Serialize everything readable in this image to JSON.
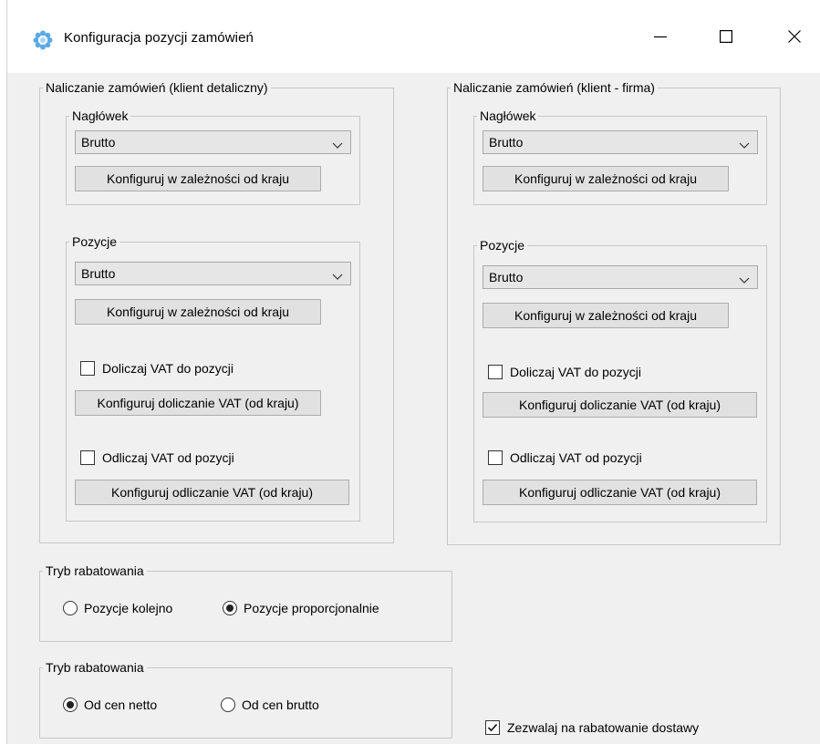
{
  "window": {
    "title": "Konfiguracja pozycji zamówień"
  },
  "retail": {
    "legend": "Naliczanie zamówień (klient detaliczny)",
    "header_group": {
      "legend": "Nagłówek",
      "combo_value": "Brutto",
      "config_button": "Konfiguruj w zależności od kraju"
    },
    "positions_group": {
      "legend": "Pozycje",
      "combo_value": "Brutto",
      "config_button": "Konfiguruj w zależności od kraju",
      "add_vat_label": "Doliczaj VAT do pozycji",
      "add_vat_checked": false,
      "add_vat_button": "Konfiguruj doliczanie VAT (od kraju)",
      "sub_vat_label": "Odliczaj VAT od pozycji",
      "sub_vat_checked": false,
      "sub_vat_button": "Konfiguruj odliczanie VAT (od kraju)"
    }
  },
  "company": {
    "legend": "Naliczanie zamówień (klient - firma)",
    "header_group": {
      "legend": "Nagłówek",
      "combo_value": "Brutto",
      "config_button": "Konfiguruj w zależności od kraju"
    },
    "positions_group": {
      "legend": "Pozycje",
      "combo_value": "Brutto",
      "config_button": "Konfiguruj w zależności od kraju",
      "add_vat_label": "Doliczaj VAT do pozycji",
      "add_vat_checked": false,
      "add_vat_button": "Konfiguruj doliczanie VAT (od kraju)",
      "sub_vat_label": "Odliczaj VAT od pozycji",
      "sub_vat_checked": false,
      "sub_vat_button": "Konfiguruj odliczanie VAT (od kraju)"
    }
  },
  "discount_mode": {
    "legend": "Tryb rabatowania",
    "options": [
      {
        "label": "Pozycje kolejno",
        "selected": false
      },
      {
        "label": "Pozycje proporcjonalnie",
        "selected": true
      }
    ]
  },
  "discount_base": {
    "legend": "Tryb rabatowania",
    "options": [
      {
        "label": "Od cen netto",
        "selected": true
      },
      {
        "label": "Od cen brutto",
        "selected": false
      }
    ]
  },
  "allow_shipping_discount": {
    "label": "Zezwalaj na rabatowanie dostawy",
    "checked": true
  },
  "icons": {
    "app": "gear-flower-icon",
    "minimize": "minimize-icon",
    "maximize": "maximize-icon",
    "close": "close-icon",
    "dropdown": "chevron-down-icon",
    "check": "checkmark-icon"
  },
  "colors": {
    "app_icon": "#5aa9e6",
    "window_bg": "#f0f0f0",
    "button_bg": "#e1e1e1",
    "border": "#adadad"
  }
}
